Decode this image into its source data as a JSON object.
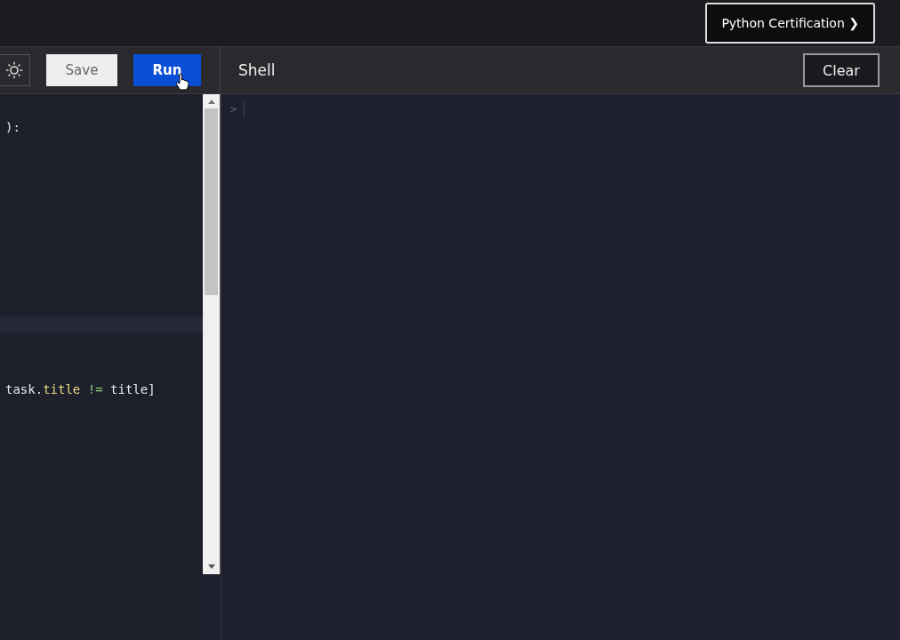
{
  "top_bar": {
    "certification_button": "Python Certification ❯"
  },
  "toolbar": {
    "save_button": "Save",
    "run_button": "Run",
    "shell_title": "Shell",
    "clear_button": "Clear"
  },
  "editor": {
    "lines": [
      {
        "tokens": [
          {
            "kind": "punct",
            "text": "):"
          }
        ]
      },
      {
        "tokens": [
          {
            "kind": "name",
            "text": "task."
          },
          {
            "kind": "attr",
            "text": "title"
          },
          {
            "kind": "op",
            "text": " != "
          },
          {
            "kind": "name",
            "text": "title]"
          }
        ]
      }
    ]
  },
  "shell": {
    "prompt": ">"
  }
}
